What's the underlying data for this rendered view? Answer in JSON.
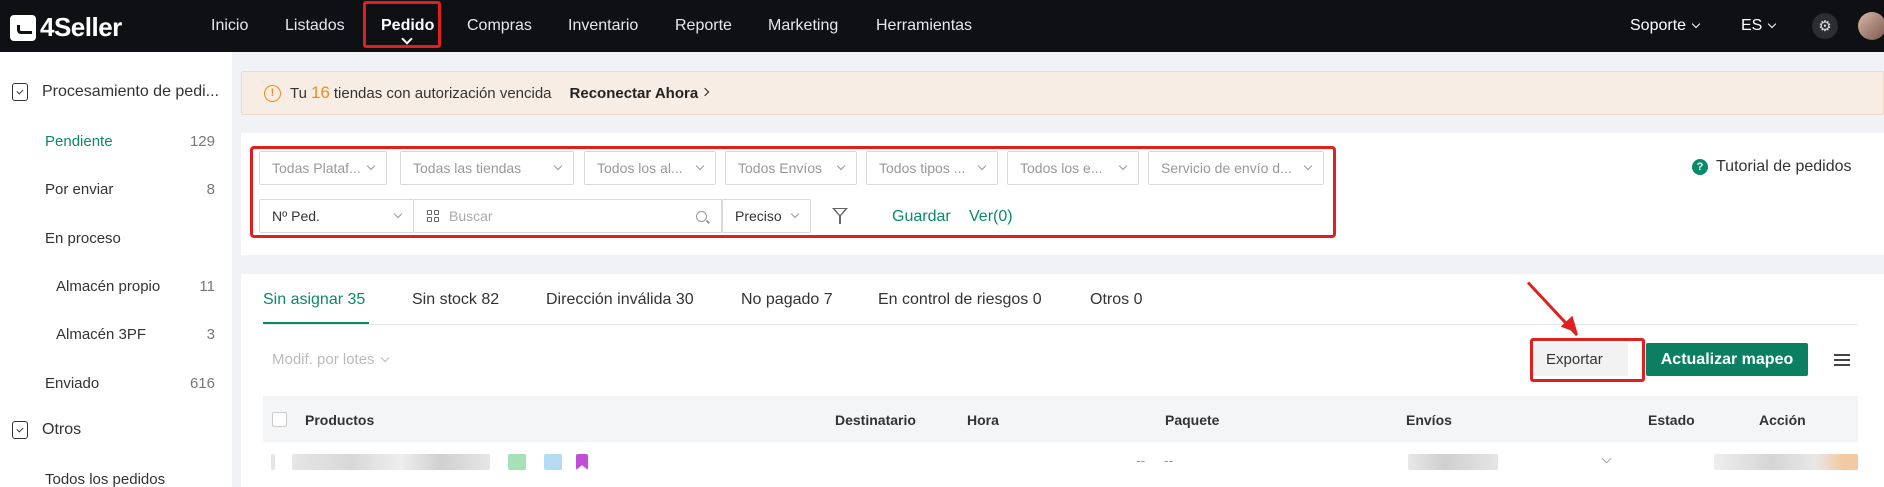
{
  "brand": {
    "name": "4Seller"
  },
  "nav": {
    "items": [
      "Inicio",
      "Listados",
      "Pedido",
      "Compras",
      "Inventario",
      "Reporte",
      "Marketing",
      "Herramientas"
    ],
    "active": "Pedido",
    "support": "Soporte",
    "language": "ES",
    "icons": [
      "gear-icon",
      "avatar"
    ]
  },
  "sidebar": {
    "section1": "Procesamiento de pedi...",
    "items": [
      {
        "label": "Pendiente",
        "count": "129"
      },
      {
        "label": "Por enviar",
        "count": "8"
      },
      {
        "label": "En proceso",
        "count": ""
      },
      {
        "label": "Almacén propio",
        "count": "11"
      },
      {
        "label": "Almacén 3PF",
        "count": "3"
      },
      {
        "label": "Enviado",
        "count": "616"
      }
    ],
    "section2": "Otros",
    "extra_item": "Todos los pedidos"
  },
  "banner": {
    "prefix": "Tu",
    "count": "16",
    "text": "tiendas con autorización vencida",
    "action": "Reconectar Ahora"
  },
  "filters": {
    "selects": [
      "Todas Plataf...",
      "Todas las tiendas",
      "Todos los al...",
      "Todos Envíos",
      "Todos tipos ...",
      "Todos los e...",
      "Servicio de envío d..."
    ],
    "order_field": "Nº Ped.",
    "search_placeholder": "Buscar",
    "match_mode": "Preciso",
    "save": "Guardar",
    "view": "Ver(0)",
    "tutorial": "Tutorial de pedidos"
  },
  "tabs": [
    "Sin asignar 35",
    "Sin stock 82",
    "Dirección inválida 30",
    "No pagado 7",
    "En control de riesgos 0",
    "Otros 0"
  ],
  "toolbar": {
    "batch": "Modif. por lotes",
    "export": "Exportar",
    "update_mapping": "Actualizar mapeo"
  },
  "table": {
    "columns": [
      "Productos",
      "Destinatario",
      "Hora",
      "Paquete",
      "Envíos",
      "Estado",
      "Acción"
    ],
    "row_placeholders": [
      "--",
      "--"
    ]
  },
  "colors": {
    "accent": "#0b8a6b",
    "highlight": "#e02020",
    "warning": "#f08a24"
  }
}
